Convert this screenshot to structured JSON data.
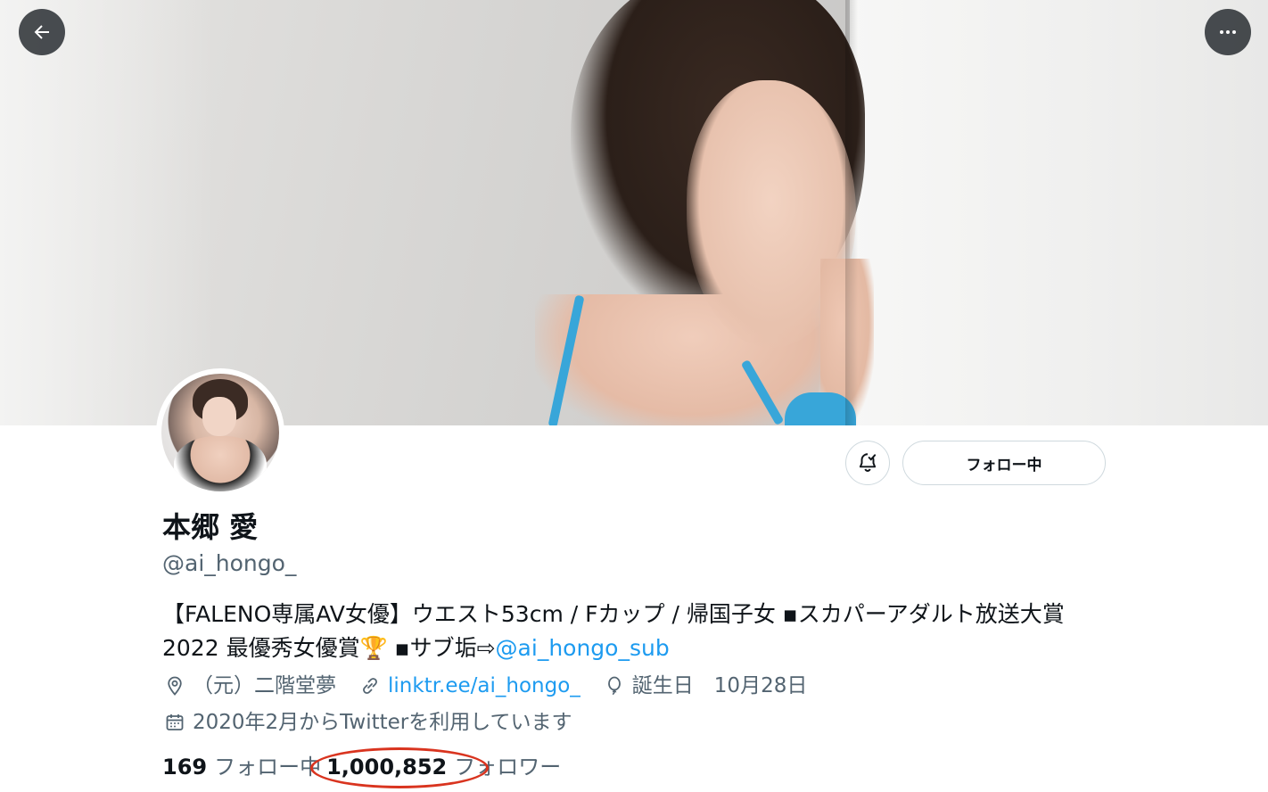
{
  "header": {
    "back_icon": "arrow-left-icon",
    "more_icon": "more-horizontal-icon"
  },
  "profile": {
    "display_name": "本郷 愛",
    "handle": "@ai_hongo_",
    "bio_text": "【FALENO専属AV女優】ウエスト53cm / Fカップ / 帰国子女 ▪スカパーアダルト放送大賞2022 最優秀女優賞🏆 ▪サブ垢⇨",
    "bio_link": "@ai_hongo_sub",
    "location": "（元）二階堂夢",
    "website": "linktr.ee/ai_hongo_",
    "birthday": "誕生日　10月28日",
    "joined": "2020年2月からTwitterを利用しています"
  },
  "actions": {
    "notify_icon": "bell-check-icon",
    "follow_label": "フォロー中"
  },
  "stats": {
    "following_count": "169",
    "following_label": "フォロー中",
    "followers_count": "1,000,852",
    "followers_label": "フォロワー"
  },
  "annotation": {
    "oval_color": "#d9341f"
  }
}
